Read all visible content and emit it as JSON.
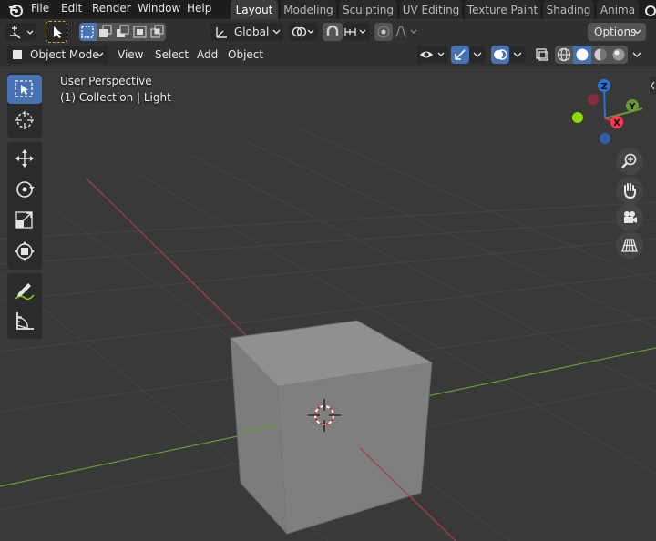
{
  "menu": {
    "items": [
      "File",
      "Edit",
      "Render",
      "Window",
      "Help"
    ]
  },
  "workspace_tabs": [
    {
      "label": "Layout",
      "active": true
    },
    {
      "label": "Modeling",
      "active": false
    },
    {
      "label": "Sculpting",
      "active": false
    },
    {
      "label": "UV Editing",
      "active": false
    },
    {
      "label": "Texture Paint",
      "active": false
    },
    {
      "label": "Shading",
      "active": false
    },
    {
      "label": "Anima",
      "active": false
    }
  ],
  "header": {
    "transform_orientation": "Global",
    "options_label": "Options",
    "mode": "Object Mode",
    "view_menu": "View",
    "select_menu": "Select",
    "add_menu": "Add",
    "object_menu": "Object"
  },
  "viewport": {
    "perspective_label": "User Perspective",
    "collection_label": "(1) Collection | Light"
  },
  "gizmo": {
    "z_label": "Z",
    "y_label": "Y",
    "x_label": "X"
  },
  "colors": {
    "accent": "#4772b3",
    "x_axis": "#ff3352",
    "y_axis": "#8bdc00",
    "z_axis": "#2890ff",
    "viewport_bg": "#393939"
  },
  "tools": [
    "select-box-icon",
    "cursor-icon",
    "move-icon",
    "rotate-icon",
    "scale-icon",
    "transform-icon",
    "annotate-icon",
    "measure-icon"
  ]
}
